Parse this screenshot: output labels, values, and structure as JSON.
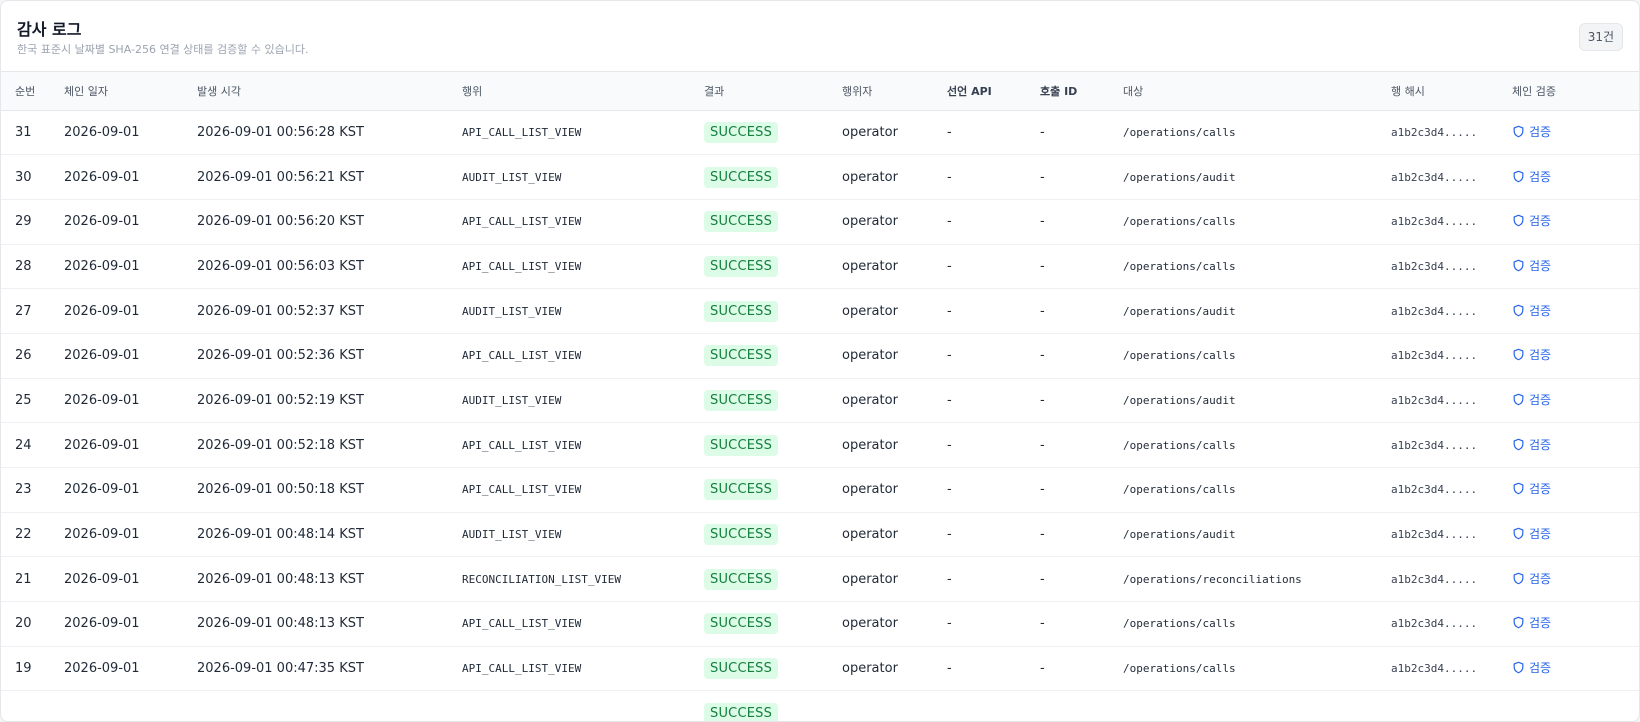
{
  "header": {
    "title": "감사 로그",
    "subtitle": "한국 표준시 날짜별 SHA-256 연결 상태를 검증할 수 있습니다.",
    "count": "31건"
  },
  "columns": {
    "seq": "순번",
    "chain_date": "체인 일자",
    "time": "발생 시각",
    "action": "행위",
    "result": "결과",
    "actor": "행위자",
    "api": "선언 API",
    "call_id": "호출 ID",
    "target": "대상",
    "row_hash": "행 해시",
    "verify": "체인 검증"
  },
  "verify_label": "검증",
  "rows": [
    {
      "seq": "31",
      "date": "2026-09-01",
      "time": "2026-09-01 00:56:28 KST",
      "action": "API_CALL_LIST_VIEW",
      "result": "SUCCESS",
      "actor": "operator",
      "api": "-",
      "call_id": "-",
      "target": "/operations/calls",
      "hash": "a1b2c3d4....."
    },
    {
      "seq": "30",
      "date": "2026-09-01",
      "time": "2026-09-01 00:56:21 KST",
      "action": "AUDIT_LIST_VIEW",
      "result": "SUCCESS",
      "actor": "operator",
      "api": "-",
      "call_id": "-",
      "target": "/operations/audit",
      "hash": "a1b2c3d4....."
    },
    {
      "seq": "29",
      "date": "2026-09-01",
      "time": "2026-09-01 00:56:20 KST",
      "action": "API_CALL_LIST_VIEW",
      "result": "SUCCESS",
      "actor": "operator",
      "api": "-",
      "call_id": "-",
      "target": "/operations/calls",
      "hash": "a1b2c3d4....."
    },
    {
      "seq": "28",
      "date": "2026-09-01",
      "time": "2026-09-01 00:56:03 KST",
      "action": "API_CALL_LIST_VIEW",
      "result": "SUCCESS",
      "actor": "operator",
      "api": "-",
      "call_id": "-",
      "target": "/operations/calls",
      "hash": "a1b2c3d4....."
    },
    {
      "seq": "27",
      "date": "2026-09-01",
      "time": "2026-09-01 00:52:37 KST",
      "action": "AUDIT_LIST_VIEW",
      "result": "SUCCESS",
      "actor": "operator",
      "api": "-",
      "call_id": "-",
      "target": "/operations/audit",
      "hash": "a1b2c3d4....."
    },
    {
      "seq": "26",
      "date": "2026-09-01",
      "time": "2026-09-01 00:52:36 KST",
      "action": "API_CALL_LIST_VIEW",
      "result": "SUCCESS",
      "actor": "operator",
      "api": "-",
      "call_id": "-",
      "target": "/operations/calls",
      "hash": "a1b2c3d4....."
    },
    {
      "seq": "25",
      "date": "2026-09-01",
      "time": "2026-09-01 00:52:19 KST",
      "action": "AUDIT_LIST_VIEW",
      "result": "SUCCESS",
      "actor": "operator",
      "api": "-",
      "call_id": "-",
      "target": "/operations/audit",
      "hash": "a1b2c3d4....."
    },
    {
      "seq": "24",
      "date": "2026-09-01",
      "time": "2026-09-01 00:52:18 KST",
      "action": "API_CALL_LIST_VIEW",
      "result": "SUCCESS",
      "actor": "operator",
      "api": "-",
      "call_id": "-",
      "target": "/operations/calls",
      "hash": "a1b2c3d4....."
    },
    {
      "seq": "23",
      "date": "2026-09-01",
      "time": "2026-09-01 00:50:18 KST",
      "action": "API_CALL_LIST_VIEW",
      "result": "SUCCESS",
      "actor": "operator",
      "api": "-",
      "call_id": "-",
      "target": "/operations/calls",
      "hash": "a1b2c3d4....."
    },
    {
      "seq": "22",
      "date": "2026-09-01",
      "time": "2026-09-01 00:48:14 KST",
      "action": "AUDIT_LIST_VIEW",
      "result": "SUCCESS",
      "actor": "operator",
      "api": "-",
      "call_id": "-",
      "target": "/operations/audit",
      "hash": "a1b2c3d4....."
    },
    {
      "seq": "21",
      "date": "2026-09-01",
      "time": "2026-09-01 00:48:13 KST",
      "action": "RECONCILIATION_LIST_VIEW",
      "result": "SUCCESS",
      "actor": "operator",
      "api": "-",
      "call_id": "-",
      "target": "/operations/reconciliations",
      "hash": "a1b2c3d4....."
    },
    {
      "seq": "20",
      "date": "2026-09-01",
      "time": "2026-09-01 00:48:13 KST",
      "action": "API_CALL_LIST_VIEW",
      "result": "SUCCESS",
      "actor": "operator",
      "api": "-",
      "call_id": "-",
      "target": "/operations/calls",
      "hash": "a1b2c3d4....."
    },
    {
      "seq": "19",
      "date": "2026-09-01",
      "time": "2026-09-01 00:47:35 KST",
      "action": "API_CALL_LIST_VIEW",
      "result": "SUCCESS",
      "actor": "operator",
      "api": "-",
      "call_id": "-",
      "target": "/operations/calls",
      "hash": "a1b2c3d4....."
    },
    {
      "seq": "",
      "date": "",
      "time": "",
      "action": "",
      "result": "SUCCESS",
      "actor": "",
      "api": "",
      "call_id": "",
      "target": "",
      "hash": ""
    }
  ],
  "colors": {
    "success_bg": "#dcfce7",
    "success_text": "#15803d",
    "link": "#2563eb"
  },
  "icons": {
    "verify": "shield-icon"
  }
}
